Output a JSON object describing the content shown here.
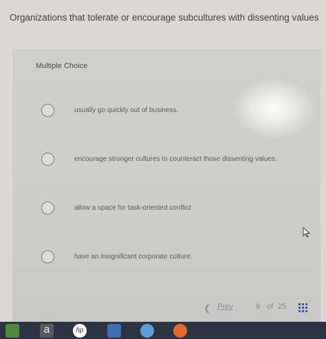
{
  "question": {
    "text": "Organizations that tolerate or encourage subcultures with dissenting values"
  },
  "section": {
    "label": "Multiple Choice"
  },
  "options": [
    {
      "text": "usually go quickly out of business."
    },
    {
      "text": "encourage stronger cultures to counteract those dissenting values."
    },
    {
      "text": "allow a space for task-oriented conflict"
    },
    {
      "text": "have an insignificant corporate culture."
    }
  ],
  "navigation": {
    "prev_label": "Prev",
    "current_page": "9",
    "of_label": "of",
    "total_pages": "25"
  },
  "icons": {
    "prev": "chevron-left-icon",
    "grid": "grid-menu-icon",
    "cursor": "mouse-pointer-icon"
  },
  "taskbar": {
    "amazon_label": "a",
    "hp_label": "hp"
  },
  "colors": {
    "page_bg": "#d9d8d6",
    "panel_bg": "#cfcfcd",
    "text": "#3e3f40",
    "link": "#7f8fa0",
    "taskbar": "#2c3444"
  }
}
